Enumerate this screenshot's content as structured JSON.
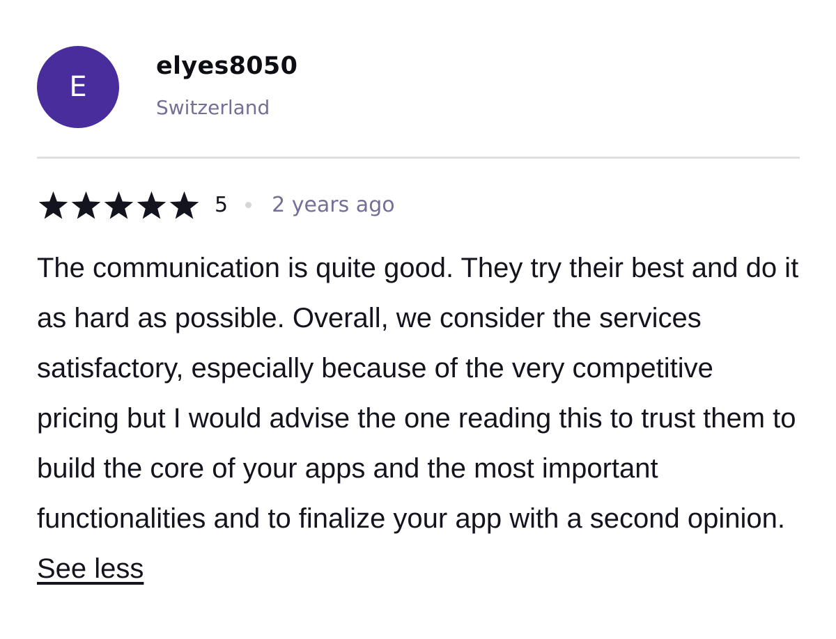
{
  "reviewer": {
    "avatar_initial": "E",
    "avatar_color": "#4a2d9c",
    "name": "elyes8050",
    "country": "Switzerland"
  },
  "review": {
    "rating": {
      "stars_filled": 5,
      "stars_total": 5,
      "label": "5",
      "icon": "star-icon"
    },
    "date": "2 years ago",
    "text": "The communication is quite good. They try their best and do it as hard as possible. Overall, we consider the services satisfactory, especially because of the very competitive pricing but I would advise the one reading this to trust them to build the core of your apps and the most important functionalities and to finalize your app with a second opinion.",
    "see_less_label": "See less"
  },
  "colors": {
    "text": "#14141f",
    "muted": "#746f96",
    "divider": "#dedee3",
    "star": "#14141f"
  }
}
